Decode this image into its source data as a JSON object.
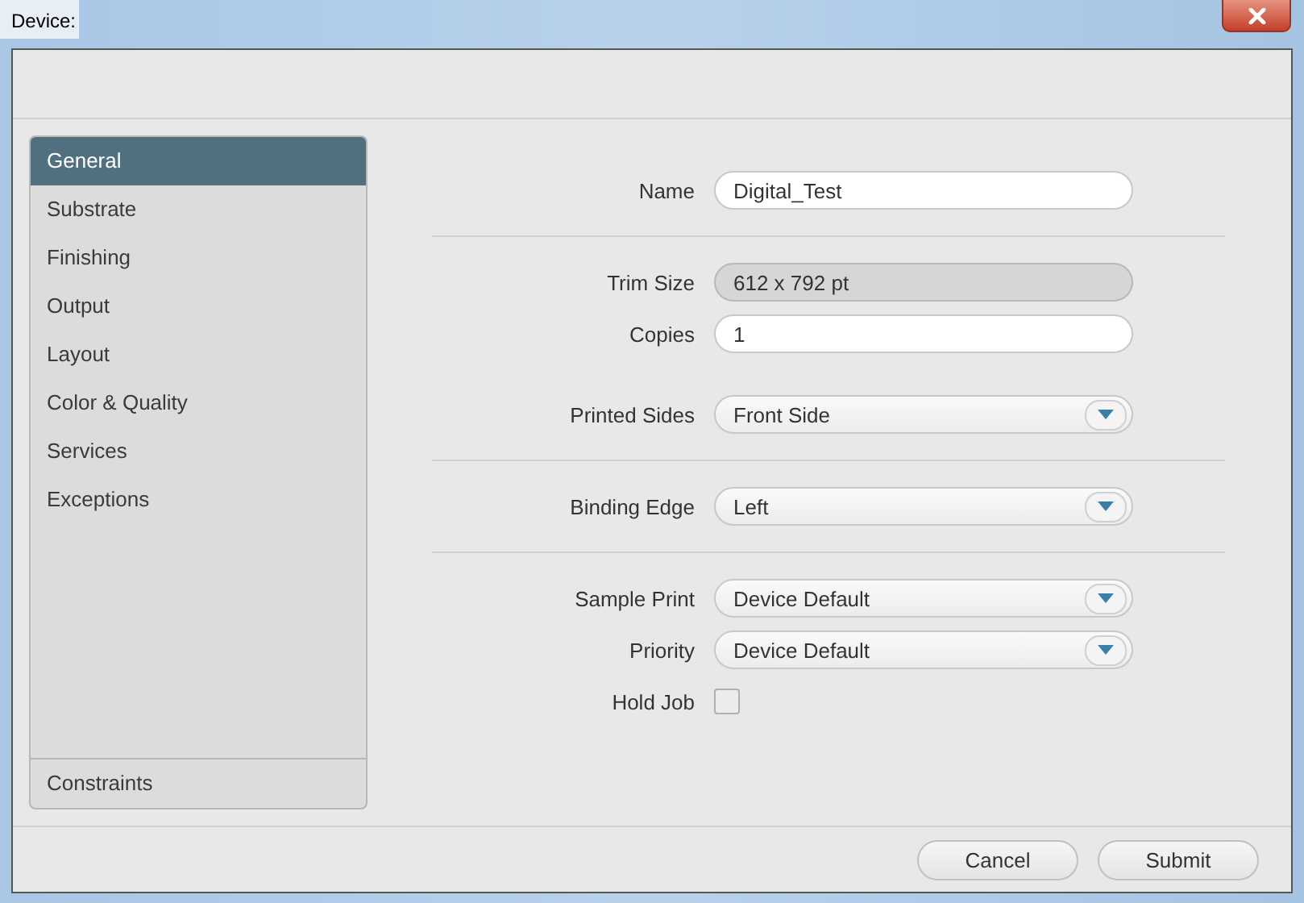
{
  "window": {
    "title": "Device:"
  },
  "sidebar": {
    "items": [
      {
        "label": "General",
        "selected": true
      },
      {
        "label": "Substrate",
        "selected": false
      },
      {
        "label": "Finishing",
        "selected": false
      },
      {
        "label": "Output",
        "selected": false
      },
      {
        "label": "Layout",
        "selected": false
      },
      {
        "label": "Color & Quality",
        "selected": false
      },
      {
        "label": "Services",
        "selected": false
      },
      {
        "label": "Exceptions",
        "selected": false
      }
    ],
    "footer_item": {
      "label": "Constraints",
      "selected": false
    }
  },
  "form": {
    "sections": [
      {
        "fields": [
          {
            "kind": "text",
            "label": "Name",
            "value": "Digital_Test"
          }
        ]
      },
      {
        "fields": [
          {
            "kind": "readonly",
            "label": "Trim Size",
            "value": "612 x 792 pt"
          },
          {
            "kind": "text",
            "label": "Copies",
            "value": "1"
          },
          {
            "kind": "dropdown",
            "label": "Printed Sides",
            "value": "Front Side"
          }
        ]
      },
      {
        "fields": [
          {
            "kind": "dropdown",
            "label": "Binding Edge",
            "value": "Left"
          }
        ]
      },
      {
        "fields": [
          {
            "kind": "dropdown",
            "label": "Sample Print",
            "value": "Device Default"
          },
          {
            "kind": "dropdown",
            "label": "Priority",
            "value": "Device Default"
          },
          {
            "kind": "checkbox",
            "label": "Hold Job",
            "checked": false
          }
        ]
      }
    ]
  },
  "buttons": [
    "Cancel",
    "Submit"
  ]
}
